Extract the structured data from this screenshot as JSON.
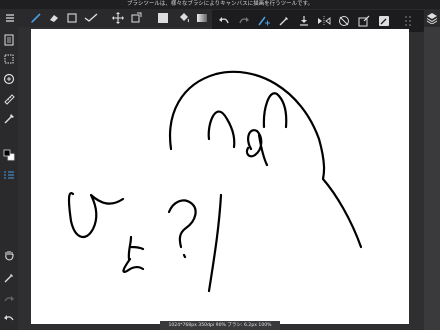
{
  "hint": {
    "text": "ブラシツールは、様々なブラシによりキャンバスに描画を行うツールです。"
  },
  "toolbar": {
    "tools": [
      "menu-icon",
      "brush-icon",
      "eraser-icon",
      "select-rect-icon",
      "check-icon",
      "move-icon",
      "transform-icon",
      "color-square-icon",
      "fill-bucket-icon",
      "gradient-icon",
      "lasso-select-icon",
      "layers-icon"
    ]
  },
  "subbar": {
    "tools": [
      "undo-icon",
      "redo-icon",
      "brush-select-icon",
      "eyedropper-icon",
      "import-icon",
      "flip-icon",
      "no-stroke-icon",
      "edit-icon",
      "reference-icon",
      "grid-icon"
    ]
  },
  "rail": {
    "tools": [
      "layers-list-icon",
      "selection-icon",
      "zoom-icon",
      "ruler-icon",
      "brush-settings-icon",
      "color-swap-icon",
      "layers-panel-icon",
      "hand-icon",
      "eyedropper-rail-icon",
      "redo-rail-icon",
      "undo-rail-icon"
    ]
  },
  "status": {
    "text": "1024*768px 350dpi 90% ブラシ: 6.2px 100%"
  },
  "colors": {
    "chrome": "#2a2a2c",
    "accent": "#4a9fe0",
    "canvas": "#ffffff",
    "ink": "#000000"
  }
}
